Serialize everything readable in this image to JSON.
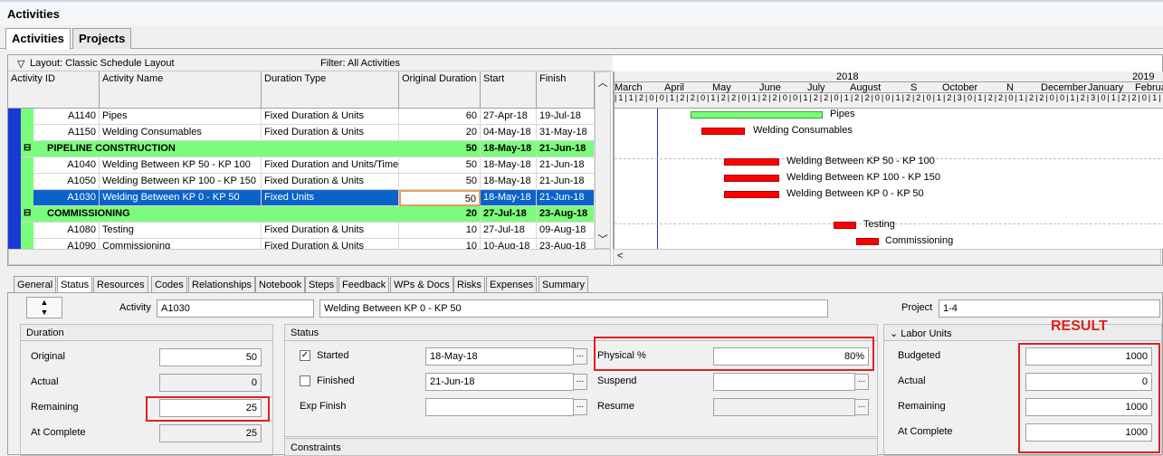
{
  "window_title": "Activities",
  "top_tabs": [
    "Activities",
    "Projects"
  ],
  "layout_label": "Layout: Classic Schedule Layout",
  "filter_label": "Filter: All Activities",
  "columns": [
    "Activity ID",
    "Activity Name",
    "Duration Type",
    "Original Duration",
    "Start",
    "Finish"
  ],
  "rows": [
    {
      "id": "A1140",
      "name": "Pipes",
      "type": "Fixed Duration & Units",
      "dur": "60",
      "start": "27-Apr-18",
      "finish": "19-Jul-18"
    },
    {
      "id": "A1150",
      "name": "Welding Consumables",
      "type": "Fixed Duration & Units",
      "dur": "20",
      "start": "04-May-18",
      "finish": "31-May-18"
    },
    {
      "wbs": "PIPELINE CONSTRUCTION",
      "dur": "50",
      "start": "18-May-18",
      "finish": "21-Jun-18"
    },
    {
      "id": "A1040",
      "name": "Welding Between KP 50 - KP 100",
      "type": "Fixed Duration and Units/Time",
      "dur": "50",
      "start": "18-May-18",
      "finish": "21-Jun-18"
    },
    {
      "id": "A1050",
      "name": "Welding Between KP 100 - KP 150",
      "type": "Fixed Duration & Units",
      "dur": "50",
      "start": "18-May-18",
      "finish": "21-Jun-18"
    },
    {
      "id": "A1030",
      "name": "Welding Between KP 0 - KP 50",
      "type": "Fixed Units",
      "dur": "50",
      "start": "18-May-18",
      "finish": "21-Jun-18"
    },
    {
      "wbs": "COMMISSIONING",
      "dur": "20",
      "start": "27-Jul-18",
      "finish": "23-Aug-18"
    },
    {
      "id": "A1080",
      "name": "Testing",
      "type": "Fixed Duration & Units",
      "dur": "10",
      "start": "27-Jul-18",
      "finish": "09-Aug-18"
    },
    {
      "id": "A1090",
      "name": "Commissioning",
      "type": "Fixed Duration & Units",
      "dur": "10",
      "start": "10-Aug-18",
      "finish": "23-Aug-18"
    }
  ],
  "gantt": {
    "years": [
      "2018",
      "2019"
    ],
    "months": [
      "March",
      "April",
      "May",
      "June",
      "July",
      "August",
      "S",
      "October",
      "N",
      "December",
      "January",
      "February"
    ],
    "bar_labels": [
      "Pipes",
      "Welding Consumables",
      "Welding Between KP 50 - KP 100",
      "Welding Between KP 100 - KP 150",
      "Welding Between KP 0 - KP 50",
      "Testing",
      "Commissioning"
    ]
  },
  "detail_tabs": [
    "General",
    "Status",
    "Resources",
    "Codes",
    "Relationships",
    "Notebook",
    "Steps",
    "Feedback",
    "WPs & Docs",
    "Risks",
    "Expenses",
    "Summary"
  ],
  "activity": {
    "label": "Activity",
    "id": "A1030",
    "name": "Welding Between KP 0 - KP 50",
    "project_label": "Project",
    "project": "1-4"
  },
  "duration": {
    "title": "Duration",
    "original_label": "Original",
    "original": "50",
    "actual_label": "Actual",
    "actual": "0",
    "remaining_label": "Remaining",
    "remaining": "25",
    "atcomplete_label": "At Complete",
    "atcomplete": "25"
  },
  "status": {
    "title": "Status",
    "started_label": "Started",
    "started_date": "18-May-18",
    "finished_label": "Finished",
    "finished_date": "21-Jun-18",
    "expfinish_label": "Exp Finish",
    "physical_label": "Physical %",
    "physical": "80%",
    "suspend_label": "Suspend",
    "resume_label": "Resume"
  },
  "constraints_title": "Constraints",
  "labor": {
    "title": "Labor Units",
    "budgeted_label": "Budgeted",
    "budgeted": "1000",
    "actual_label": "Actual",
    "actual": "0",
    "remaining_label": "Remaining",
    "remaining": "1000",
    "atcomplete_label": "At Complete",
    "atcomplete": "1000"
  },
  "result_label": "RESULT",
  "colors": {
    "wbs": "#7cfc7c",
    "selected": "#0a63c9",
    "bar": "#ff0000",
    "highlight": "#e02020"
  }
}
